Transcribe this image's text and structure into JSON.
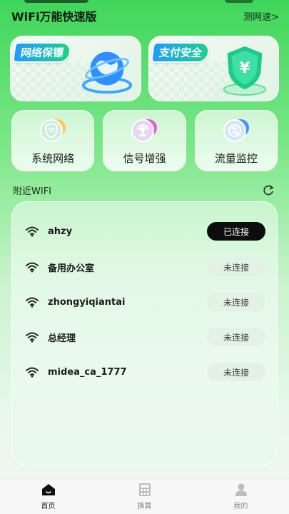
{
  "header": {
    "title": "WiFi万能快速版",
    "speed_link": "测网速>"
  },
  "banners": [
    {
      "label": "网络保镖",
      "icon": "globe-icon"
    },
    {
      "label": "支付安全",
      "icon": "shield-yuan-icon"
    }
  ],
  "features": [
    {
      "label": "系统网络",
      "icon": "wifi-shield-icon"
    },
    {
      "label": "信号增强",
      "icon": "signal-boost-icon"
    },
    {
      "label": "流量监控",
      "icon": "traffic-monitor-icon"
    }
  ],
  "nearby": {
    "title": "附近WIFI",
    "refresh_icon": "refresh-icon"
  },
  "wifi_list": [
    {
      "name": "ahzy",
      "status": "已连接",
      "connected": true
    },
    {
      "name": "备用办公室",
      "status": "未连接",
      "connected": false
    },
    {
      "name": "zhongyiqiantai",
      "status": "未连接",
      "connected": false
    },
    {
      "name": "总经理",
      "status": "未连接",
      "connected": false
    },
    {
      "name": "midea_ca_1777",
      "status": "未连接",
      "connected": false
    }
  ],
  "tabs": [
    {
      "label": "首页",
      "icon": "home-icon",
      "active": true
    },
    {
      "label": "换算",
      "icon": "calculator-icon",
      "active": false
    },
    {
      "label": "我的",
      "icon": "person-icon",
      "active": false
    }
  ],
  "colors": {
    "accent_green": "#3fd65a",
    "connected_bg": "#0d0d0d",
    "disconnected_bg": "#e4f2e6"
  }
}
